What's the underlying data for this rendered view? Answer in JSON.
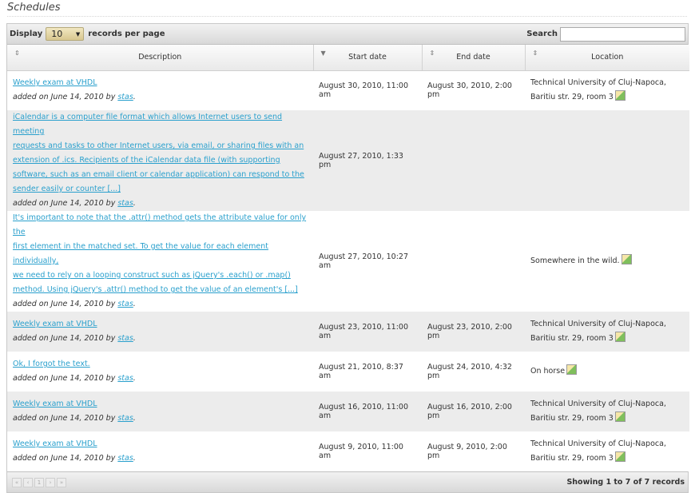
{
  "page": {
    "title": "Schedules"
  },
  "toolbar": {
    "display_label": "Display",
    "page_size": "10",
    "records_label": "records per page",
    "search_label": "Search",
    "search_value": ""
  },
  "columns": [
    {
      "label": "Description",
      "sort_icon": "⇕"
    },
    {
      "label": "Start date",
      "sort_icon": "▼"
    },
    {
      "label": "End date",
      "sort_icon": "⇕"
    },
    {
      "label": "Location",
      "sort_icon": "⇕"
    }
  ],
  "rows": [
    {
      "desc_lines": [
        "Weekly exam at VHDL"
      ],
      "added": "added on June 14, 2010 by ",
      "author": "stas",
      "start": "August 30, 2010, 11:00 am",
      "end": "August 30, 2010, 2:00 pm",
      "loc_lines": [
        "Technical University of Cluj-Napoca,",
        "Baritiu str. 29, room 3"
      ]
    },
    {
      "desc_lines": [
        "iCalendar is a computer file format which allows Internet users to send meeting",
        "requests and tasks to other Internet users, via email, or sharing files with an",
        "extension of .ics. Recipients of the iCalendar data file (with supporting",
        "software, such as an email client or calendar application) can respond to the",
        "sender easily or counter [...]"
      ],
      "added": "added on June 14, 2010 by ",
      "author": "stas",
      "start": "August 27, 2010, 1:33 pm",
      "end": "",
      "loc_lines": []
    },
    {
      "desc_lines": [
        "It's important to note that the .attr() method gets the attribute value for only the",
        "first element in the matched set. To get the value for each element individually,",
        "we need to rely on a looping construct such as jQuery's .each() or .map()",
        "method. Using jQuery's .attr() method to get the value of an element's [...]"
      ],
      "added": "added on June 14, 2010 by ",
      "author": "stas",
      "start": "August 27, 2010, 10:27 am",
      "end": "",
      "loc_lines": [
        "Somewhere in the wild."
      ]
    },
    {
      "desc_lines": [
        "Weekly exam at VHDL"
      ],
      "added": "added on June 14, 2010 by ",
      "author": "stas",
      "start": "August 23, 2010, 11:00 am",
      "end": "August 23, 2010, 2:00 pm",
      "loc_lines": [
        "Technical University of Cluj-Napoca,",
        "Baritiu str. 29, room 3"
      ]
    },
    {
      "desc_lines": [
        "Ok, I forgot the text."
      ],
      "added": "added on June 14, 2010 by ",
      "author": "stas",
      "start": "August 21, 2010, 8:37 am",
      "end": "August 24, 2010, 4:32 pm",
      "loc_lines": [
        "On horse"
      ]
    },
    {
      "desc_lines": [
        "Weekly exam at VHDL"
      ],
      "added": "added on June 14, 2010 by ",
      "author": "stas",
      "start": "August 16, 2010, 11:00 am",
      "end": "August 16, 2010, 2:00 pm",
      "loc_lines": [
        "Technical University of Cluj-Napoca,",
        "Baritiu str. 29, room 3"
      ]
    },
    {
      "desc_lines": [
        "Weekly exam at VHDL"
      ],
      "added": "added on June 14, 2010 by ",
      "author": "stas",
      "start": "August 9, 2010, 11:00 am",
      "end": "August 9, 2010, 2:00 pm",
      "loc_lines": [
        "Technical University of Cluj-Napoca,",
        "Baritiu str. 29, room 3"
      ]
    }
  ],
  "pager": {
    "first": "«",
    "prev": "‹",
    "current": "1",
    "next": "›",
    "last": "»"
  },
  "footer": {
    "info": "Showing 1 to 7 of 7 records"
  }
}
